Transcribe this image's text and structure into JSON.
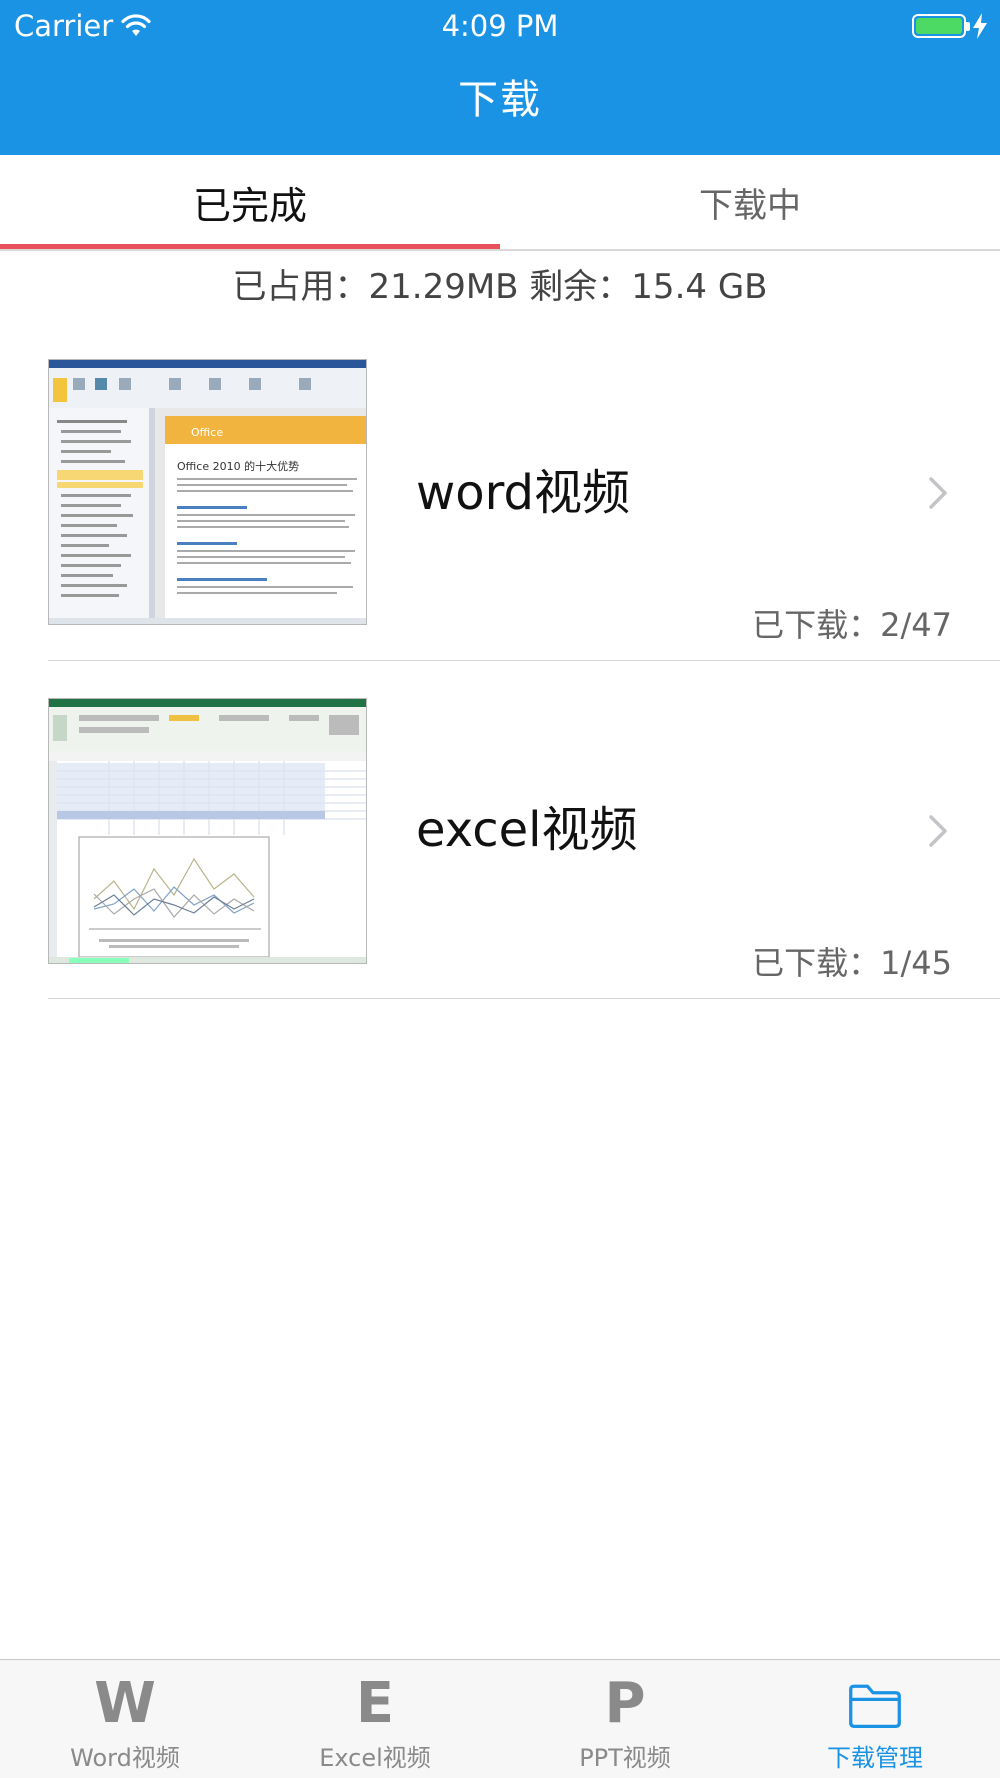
{
  "status_bar": {
    "carrier": "Carrier",
    "time": "4:09 PM",
    "battery_color": "#4cd964"
  },
  "nav": {
    "title": "下载",
    "background": "#1a93e5"
  },
  "segments": {
    "completed": "已完成",
    "downloading": "下载中",
    "active": "completed",
    "indicator_color": "#e8505b"
  },
  "storage": {
    "text": "已占用：21.29MB 剩余：15.4 GB"
  },
  "downloads": [
    {
      "title": "word视频",
      "count": "已下载：2/47",
      "thumbnail": "word-document-screenshot",
      "thumb_heading": "Office 2010 的十大优势"
    },
    {
      "title": "excel视频",
      "count": "已下载：1/45",
      "thumbnail": "excel-spreadsheet-chart-screenshot"
    }
  ],
  "tabbar": {
    "items": [
      {
        "icon": "W",
        "label": "Word视频"
      },
      {
        "icon": "E",
        "label": "Excel视频"
      },
      {
        "icon": "P",
        "label": "PPT视频"
      },
      {
        "icon": "folder-icon",
        "label": "下载管理"
      }
    ],
    "active_index": 3,
    "active_color": "#1a93e5"
  }
}
